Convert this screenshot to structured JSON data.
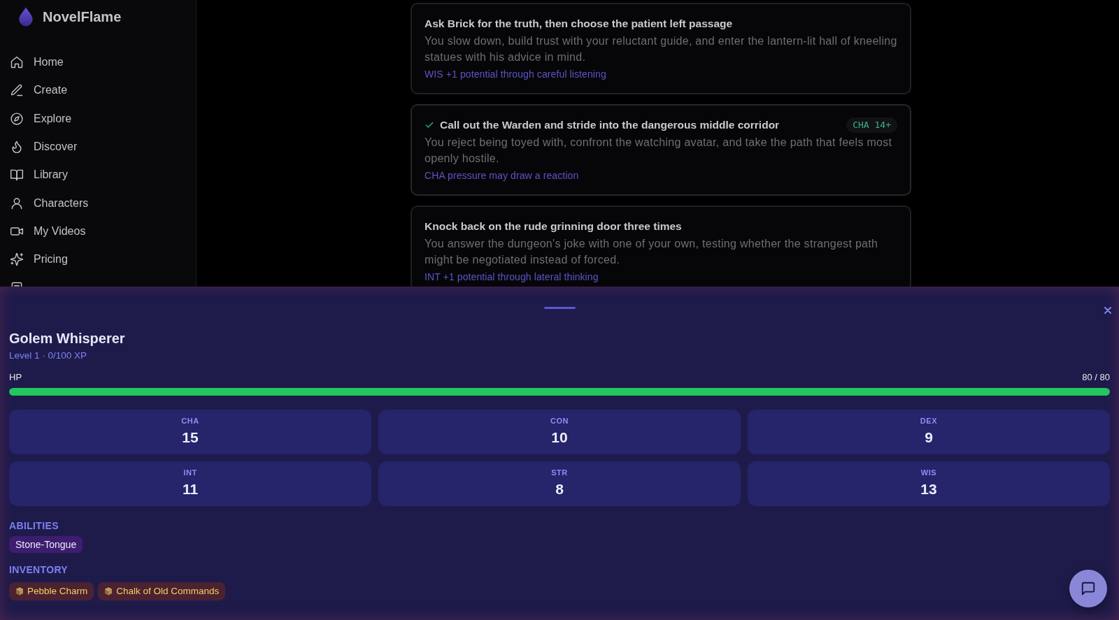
{
  "sidebar": {
    "brand": "NovelFlame",
    "items": [
      {
        "label": "Home"
      },
      {
        "label": "Create"
      },
      {
        "label": "Explore"
      },
      {
        "label": "Discover"
      },
      {
        "label": "Library"
      },
      {
        "label": "Characters"
      },
      {
        "label": "My Videos"
      },
      {
        "label": "Pricing"
      }
    ]
  },
  "choices": [
    {
      "title": "Ask Brick for the truth, then choose the patient left passage",
      "description": "You slow down, build trust with your reluctant guide, and enter the lantern-lit hall of kneeling statues with his advice in mind.",
      "hint": "WIS +1 potential through careful listening",
      "selected": false
    },
    {
      "title": "Call out the Warden and stride into the dangerous middle corridor",
      "description": "You reject being toyed with, confront the watching avatar, and take the path that feels most openly hostile.",
      "hint": "CHA pressure may draw a reaction",
      "requirement": "CHA 14+",
      "selected": true
    },
    {
      "title": "Knock back on the rude grinning door three times",
      "description": "You answer the dungeon's joke with one of your own, testing whether the strangest path might be negotiated instead of forced.",
      "hint": "INT +1 potential through lateral thinking",
      "selected": false
    }
  ],
  "character_sheet": {
    "name": "Golem Whisperer",
    "subtitle": "Level 1 · 0/100 XP",
    "hp": {
      "label": "HP",
      "reading": "80 / 80",
      "level": 1
    },
    "stats": [
      {
        "label": "CHA",
        "value": "15"
      },
      {
        "label": "CON",
        "value": "10"
      },
      {
        "label": "DEX",
        "value": "9"
      },
      {
        "label": "INT",
        "value": "11"
      },
      {
        "label": "STR",
        "value": "8"
      },
      {
        "label": "WIS",
        "value": "13"
      }
    ],
    "abilities": {
      "heading": "ABILITIES",
      "items": [
        "Stone-Tongue"
      ]
    },
    "inventory": {
      "heading": "INVENTORY",
      "items": [
        "Pebble Charm",
        "Chalk of Old Commands"
      ]
    }
  }
}
